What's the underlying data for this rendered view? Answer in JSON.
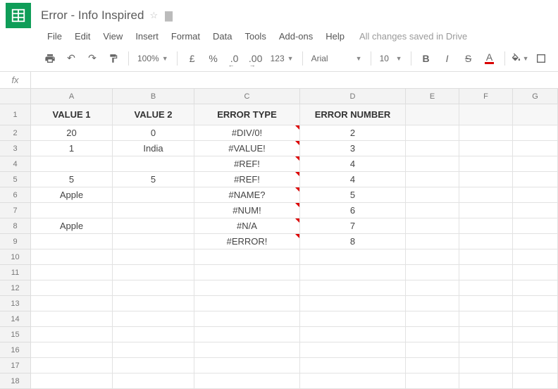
{
  "doc": {
    "title": "Error - Info Inspired"
  },
  "menu": {
    "file": "File",
    "edit": "Edit",
    "view": "View",
    "insert": "Insert",
    "format": "Format",
    "data": "Data",
    "tools": "Tools",
    "addons": "Add-ons",
    "help": "Help",
    "save": "All changes saved in Drive"
  },
  "toolbar": {
    "zoom": "100%",
    "currency": "£",
    "percent": "%",
    "dec_dec": ".0",
    "dec_inc": ".00",
    "num_format": "123",
    "font": "Arial",
    "size": "10",
    "bold": "B",
    "italic": "I",
    "strike": "S",
    "textcolor": "A"
  },
  "columns": [
    "A",
    "B",
    "C",
    "D",
    "E",
    "F",
    "G"
  ],
  "headers": {
    "a": "VALUE 1",
    "b": "VALUE 2",
    "c": "ERROR TYPE",
    "d": "ERROR NUMBER"
  },
  "rows": [
    {
      "a": "20",
      "b": "0",
      "c": "#DIV/0!",
      "d": "2",
      "err": true
    },
    {
      "a": "1",
      "b": "India",
      "c": "#VALUE!",
      "d": "3",
      "err": true
    },
    {
      "a": "",
      "b": "",
      "c": "#REF!",
      "d": "4",
      "err": true
    },
    {
      "a": "5",
      "b": "5",
      "c": "#REF!",
      "d": "4",
      "err": true
    },
    {
      "a": "Apple",
      "b": "",
      "c": "#NAME?",
      "d": "5",
      "err": true
    },
    {
      "a": "",
      "b": "",
      "c": "#NUM!",
      "d": "6",
      "err": true
    },
    {
      "a": "Apple",
      "b": "",
      "c": "#N/A",
      "d": "7",
      "err": true
    },
    {
      "a": "",
      "b": "",
      "c": "#ERROR!",
      "d": "8",
      "err": true
    },
    {
      "a": "",
      "b": "",
      "c": "",
      "d": ""
    },
    {
      "a": "",
      "b": "",
      "c": "",
      "d": ""
    },
    {
      "a": "",
      "b": "",
      "c": "",
      "d": ""
    },
    {
      "a": "",
      "b": "",
      "c": "",
      "d": ""
    },
    {
      "a": "",
      "b": "",
      "c": "",
      "d": ""
    },
    {
      "a": "",
      "b": "",
      "c": "",
      "d": ""
    },
    {
      "a": "",
      "b": "",
      "c": "",
      "d": ""
    },
    {
      "a": "",
      "b": "",
      "c": "",
      "d": ""
    },
    {
      "a": "",
      "b": "",
      "c": "",
      "d": ""
    }
  ]
}
